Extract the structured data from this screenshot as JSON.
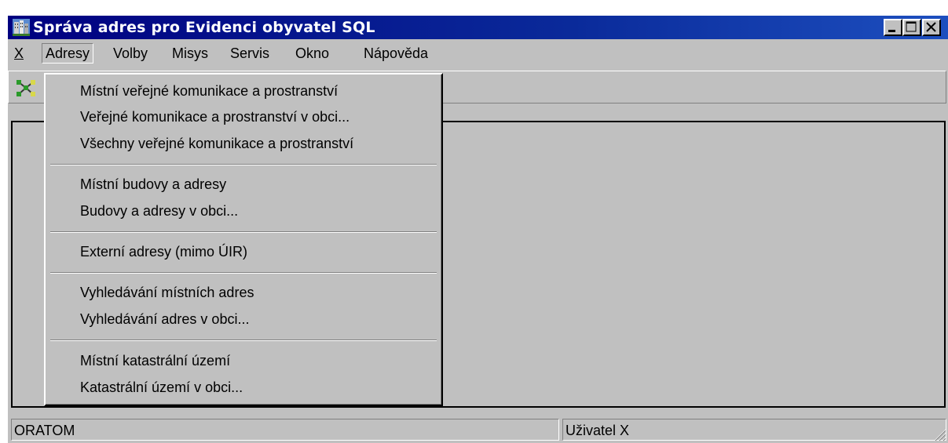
{
  "window": {
    "title": "Správa adres pro Evidenci obyvatel SQL"
  },
  "menubar": {
    "items": [
      {
        "label": "X"
      },
      {
        "label": "Adresy"
      },
      {
        "label": "Volby"
      },
      {
        "label": "Misys"
      },
      {
        "label": "Servis"
      },
      {
        "label": "Okno"
      },
      {
        "label": "Nápověda"
      }
    ]
  },
  "dropdown": {
    "items": [
      {
        "label": "Místní veřejné komunikace a prostranství"
      },
      {
        "label": "Veřejné komunikace a prostranství v obci..."
      },
      {
        "label": "Všechny veřejné komunikace a prostranství"
      },
      {
        "label": "Místní budovy a adresy"
      },
      {
        "label": "Budovy a adresy v obci..."
      },
      {
        "label": "Externí adresy (mimo ÚIR)"
      },
      {
        "label": "Vyhledávání místních adres"
      },
      {
        "label": "Vyhledávání adres v obci..."
      },
      {
        "label": "Místní katastrální území"
      },
      {
        "label": "Katastrální území v obci..."
      }
    ]
  },
  "statusbar": {
    "left": "ORATOM",
    "right": "Uživatel X"
  },
  "icons": {
    "app": "buildings-icon",
    "toolbar": "network-icon"
  },
  "colors": {
    "title_bar": "#000080",
    "face": "#c0c0c0"
  }
}
